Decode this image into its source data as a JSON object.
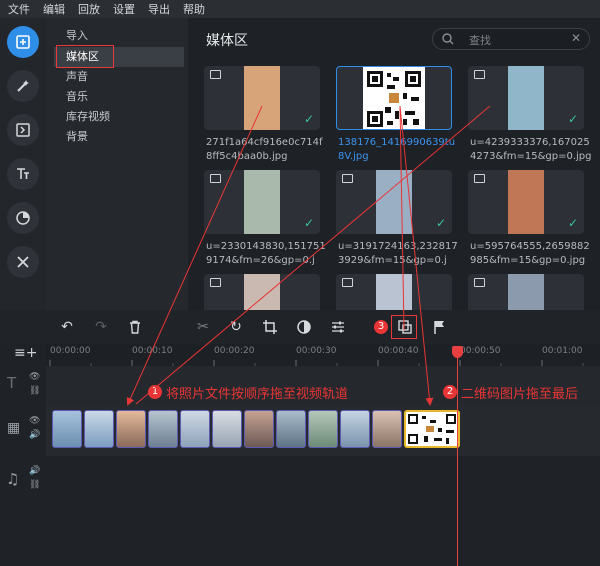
{
  "menu": [
    "文件",
    "编辑",
    "回放",
    "设置",
    "导出",
    "帮助"
  ],
  "categories": [
    "导入",
    "媒体区",
    "声音",
    "音乐",
    "库存视频",
    "背景"
  ],
  "selected_category": "媒体区",
  "media": {
    "title": "媒体区",
    "search_placeholder": "查找",
    "tiles": [
      {
        "caption": "271f1a64cf916e0c714f8ff5c4baa0b.jpg",
        "thumb": "#d7a47a"
      },
      {
        "caption": "138176_1416990639tu8V.jpg",
        "thumb": "#ffffff",
        "selected": true
      },
      {
        "caption": "u=4239333376,1670254273&fm=15&gp=0.jpg",
        "thumb": "#8fb7c9"
      },
      {
        "caption": "u=2330143830,1517519174&fm=26&gp=0.j",
        "thumb": "#a9b9ab"
      },
      {
        "caption": "u=3191724163,2328173929&fm=15&gp=0.j",
        "thumb": "#9aaec4"
      },
      {
        "caption": "u=595764555,2659882985&fm=15&gp=0.jpg",
        "thumb": "#c07756"
      },
      {
        "caption": "",
        "thumb": "#c9b9b1"
      },
      {
        "caption": "",
        "thumb": "#b9c3d2"
      },
      {
        "caption": "",
        "thumb": "#8c9aad"
      }
    ]
  },
  "timeline": {
    "ticks": [
      "00:00:00",
      "00:00:10",
      "00:00:20",
      "00:00:30",
      "00:00:40",
      "00:00:50",
      "00:01:00"
    ],
    "clip_count": 12
  },
  "annotations": {
    "a1": "将照片文件按顺序拖至视频轨道",
    "a2": "二维码图片拖至最后",
    "n1": "1",
    "n2": "2",
    "n3": "3"
  },
  "colors": {
    "accent": "#2f8ee8",
    "annotation": "#e83535",
    "qr_border": "#e7b72c"
  }
}
